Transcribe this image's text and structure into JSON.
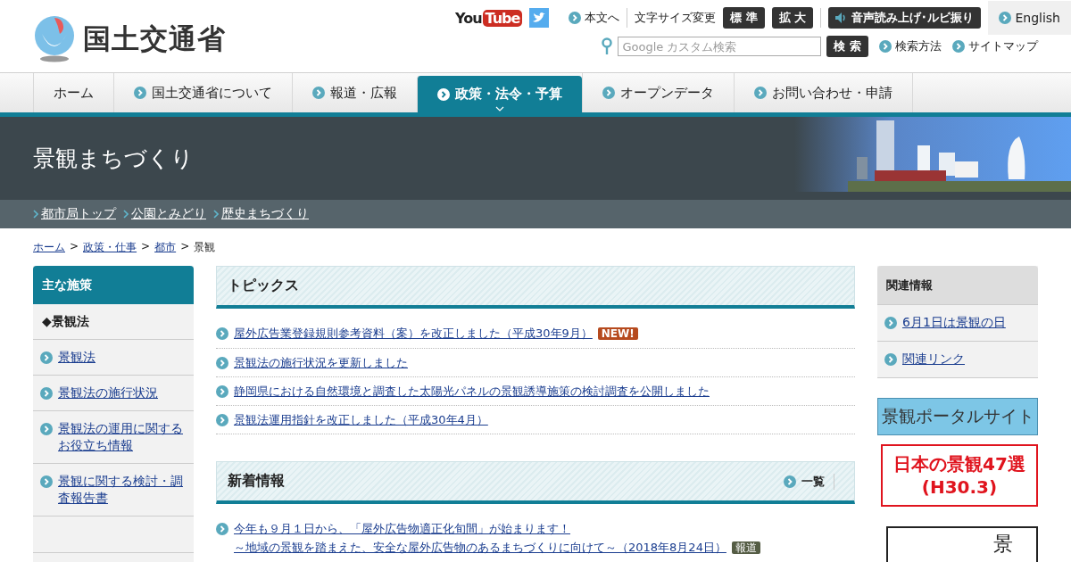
{
  "header": {
    "site_name": "国土交通省",
    "youtube": {
      "you": "You",
      "tube": "Tube"
    },
    "skip_link": "本文へ",
    "font_size_label": "文字サイズ変更",
    "font_size_buttons": [
      {
        "label": "標 準"
      },
      {
        "label": "拡 大"
      }
    ],
    "speech_button": "音声読み上げ･ルビ振り",
    "english": "English",
    "search": {
      "placeholder": "Google カスタム検索",
      "button": "検 索"
    },
    "links": [
      "検索方法",
      "サイトマップ"
    ]
  },
  "nav": [
    {
      "label": "ホーム",
      "selected": false,
      "kind": "plain"
    },
    {
      "label": "国土交通省について",
      "selected": false,
      "kind": "arrow"
    },
    {
      "label": "報道・広報",
      "selected": false,
      "kind": "arrow"
    },
    {
      "label": "政策・法令・予算",
      "selected": true,
      "kind": "arrow"
    },
    {
      "label": "オープンデータ",
      "selected": false,
      "kind": "arrow"
    },
    {
      "label": "お問い合わせ・申請",
      "selected": false,
      "kind": "arrow"
    }
  ],
  "banner": {
    "title": "景観まちづくり",
    "sub_links": [
      "都市局トップ",
      "公園とみどり",
      "歴史まちづくり"
    ]
  },
  "breadcrumb": {
    "links": [
      "ホーム",
      "政策・仕事",
      "都市"
    ],
    "separator": ">",
    "current": "景観"
  },
  "sidebar": {
    "title": "主な施策",
    "items": [
      {
        "label": "◆景観法",
        "kind": "heading"
      },
      {
        "label": "景観法",
        "kind": "link"
      },
      {
        "label": "景観法の施行状況",
        "kind": "link"
      },
      {
        "label": "景観法の運用に関するお役立ち情報",
        "kind": "link"
      },
      {
        "label": "景観に関する検討・調査報告書",
        "kind": "link"
      }
    ]
  },
  "topics": {
    "title": "トピックス",
    "items": [
      {
        "text": "屋外広告業登録規則参考資料（案）を改正しました（平成30年9月）",
        "badge": "NEW!"
      },
      {
        "text": "景観法の施行状況を更新しました"
      },
      {
        "text": "静岡県における自然環境と調査した太陽光パネルの景観誘導施策の検討調査を公開しました"
      },
      {
        "text": "景観法運用指針を改正しました（平成30年4月）"
      }
    ]
  },
  "news": {
    "title": "新着情報",
    "list_link": "一覧",
    "items": [
      {
        "lines": [
          "今年も９月１日から、「屋外広告物適正化旬間」が始まります！",
          "～地域の景観を踏まえた、安全な屋外広告物のあるまちづくりに向けて～（2018年8月24日）"
        ],
        "badge": "報道"
      }
    ]
  },
  "related": {
    "title": "関連情報",
    "items": [
      "6月1日は景観の日",
      "関連リンク"
    ],
    "portal_banner": "景観ポータルサイト",
    "selection_banner": [
      "日本の景観47選",
      "(H30.3)"
    ],
    "calligraphy_banner": "景"
  }
}
